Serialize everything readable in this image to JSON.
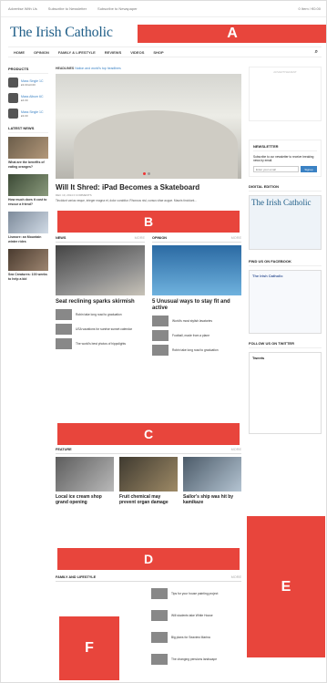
{
  "topbar": {
    "links": [
      "Advertise With Us",
      "Subscribe to Newsletter",
      "Subscribe to Newspaper"
    ],
    "cart": "0 Item / €0.00"
  },
  "logo": "The Irish Catholic",
  "nav": {
    "items": [
      "HOME",
      "OPINION",
      "FAMILY & LIFESTYLE",
      "REVIEWS",
      "VIDEOS",
      "SHOP"
    ]
  },
  "left": {
    "products_title": "PRODUCTS",
    "products": [
      {
        "name": "Mass Single 1C",
        "price": "£3.00 £3.00"
      },
      {
        "name": "Mass Album 6C",
        "price": "£4.00"
      },
      {
        "name": "Mass Single 1C",
        "price": "£3.00"
      }
    ],
    "latest_title": "LATEST NEWS",
    "latest": [
      "What are the benefits of eating oranges?",
      "How much does it cost to rescue a friend?",
      "Lismore: an Mountain winter rides",
      "Sea Creatures: 100 weeks to help a kid"
    ]
  },
  "main": {
    "headlines_label": "HEADLINES",
    "headlines_link": "Nation and world's top headlines",
    "hero_title": "Will It Shred: iPad Becomes a Skateboard",
    "hero_meta": "DEC 10, 2014   0 COMMENTS",
    "hero_excerpt": "Tincidunt varius neque, integer magna et, dolor curabitur. Rhoncus nisl, cursus vitae augue. Mauris tincidunt...",
    "news_label": "NEWS",
    "opinion_label": "OPINION",
    "more_label": "MORE",
    "news_title": "Seat reclining sparks skirmish",
    "opinion_title": "5 Unusual ways to stay fit and active",
    "news_items": [
      "Robin take long road to graduation",
      "USA vacations for sunrise sunset calendar",
      "The world's best photos of hippolights"
    ],
    "opinion_items": [
      "World's most stylish lavatories",
      "Football, made from a plane",
      "Robin take long road to graduation"
    ],
    "feature_label": "FEATURE",
    "features": [
      {
        "title": "Local ice cream shop grand opening"
      },
      {
        "title": "Fruit chemical may prevent organ damage"
      },
      {
        "title": "Sailor's ship was hit by kamikaze"
      }
    ],
    "family_label": "FAMILY AND LIFESTYLE",
    "family_items": [
      "Tips for your house painting project",
      "Will students take White House",
      "Big plans for Seaview Marina",
      "The changing pensions landscape"
    ]
  },
  "right": {
    "ad_label": "ADVERTISEMENT",
    "newsletter_title": "NEWSLETTER",
    "newsletter_text": "Subscribe to our newsletter to receive breaking news by email.",
    "newsletter_placeholder": "Enter your email",
    "newsletter_button": "Signup",
    "digital_title": "DIGITAL EDITION",
    "cover_title": "The Irish Catholic",
    "fb_title": "FIND US ON FACEBOOK",
    "fb_name": "The Irish Catholic",
    "twitter_title": "FOLLOW US ON TWITTER",
    "tweets_label": "Tweets"
  },
  "labels": {
    "A": "A",
    "B": "B",
    "C": "C",
    "D": "D",
    "E": "E",
    "F": "F"
  },
  "colors": {
    "banner": "#e8453c",
    "accent": "#3b82c4",
    "logo": "#1f5e88"
  }
}
